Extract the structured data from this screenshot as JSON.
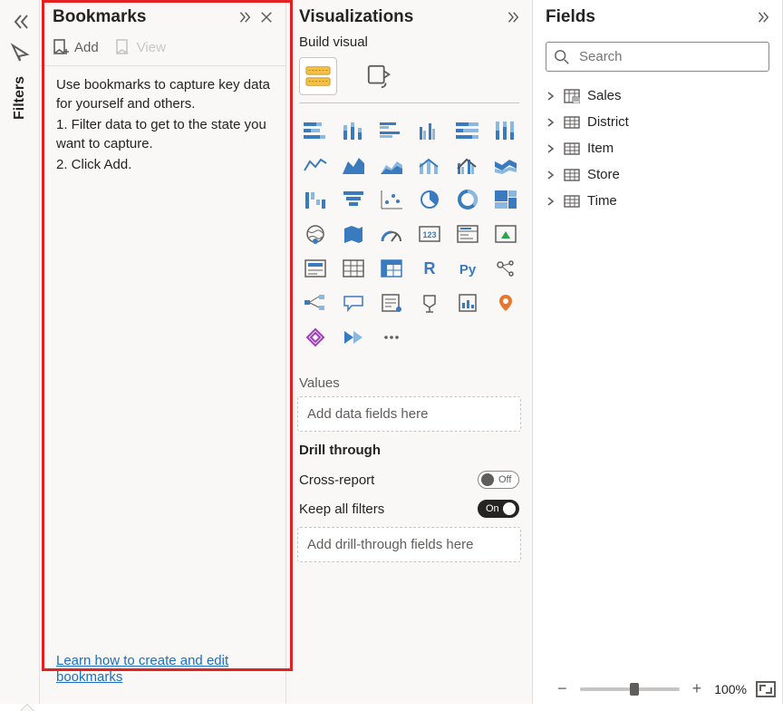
{
  "rail": {
    "filters_label": "Filters"
  },
  "bookmarks": {
    "title": "Bookmarks",
    "add_label": "Add",
    "view_label": "View",
    "help_text": "Use bookmarks to capture key data for yourself and others.",
    "step1": "1. Filter data to get to the state you want to capture.",
    "step2": "2. Click Add.",
    "link_text": "Learn how to create and edit bookmarks"
  },
  "visualizations": {
    "title": "Visualizations",
    "build_label": "Build visual",
    "values_label": "Values",
    "values_placeholder": "Add data fields here",
    "drill_label": "Drill through",
    "cross_report_label": "Cross-report",
    "cross_report_state": "Off",
    "keep_filters_label": "Keep all filters",
    "keep_filters_state": "On",
    "drill_placeholder": "Add drill-through fields here"
  },
  "fields": {
    "title": "Fields",
    "search_placeholder": "Search",
    "items": [
      {
        "name": "Sales",
        "icon": "calc-table"
      },
      {
        "name": "District",
        "icon": "table"
      },
      {
        "name": "Item",
        "icon": "table"
      },
      {
        "name": "Store",
        "icon": "table"
      },
      {
        "name": "Time",
        "icon": "table"
      }
    ]
  },
  "footer": {
    "zoom_minus": "−",
    "zoom_plus": "+",
    "zoom_value": "100%"
  }
}
